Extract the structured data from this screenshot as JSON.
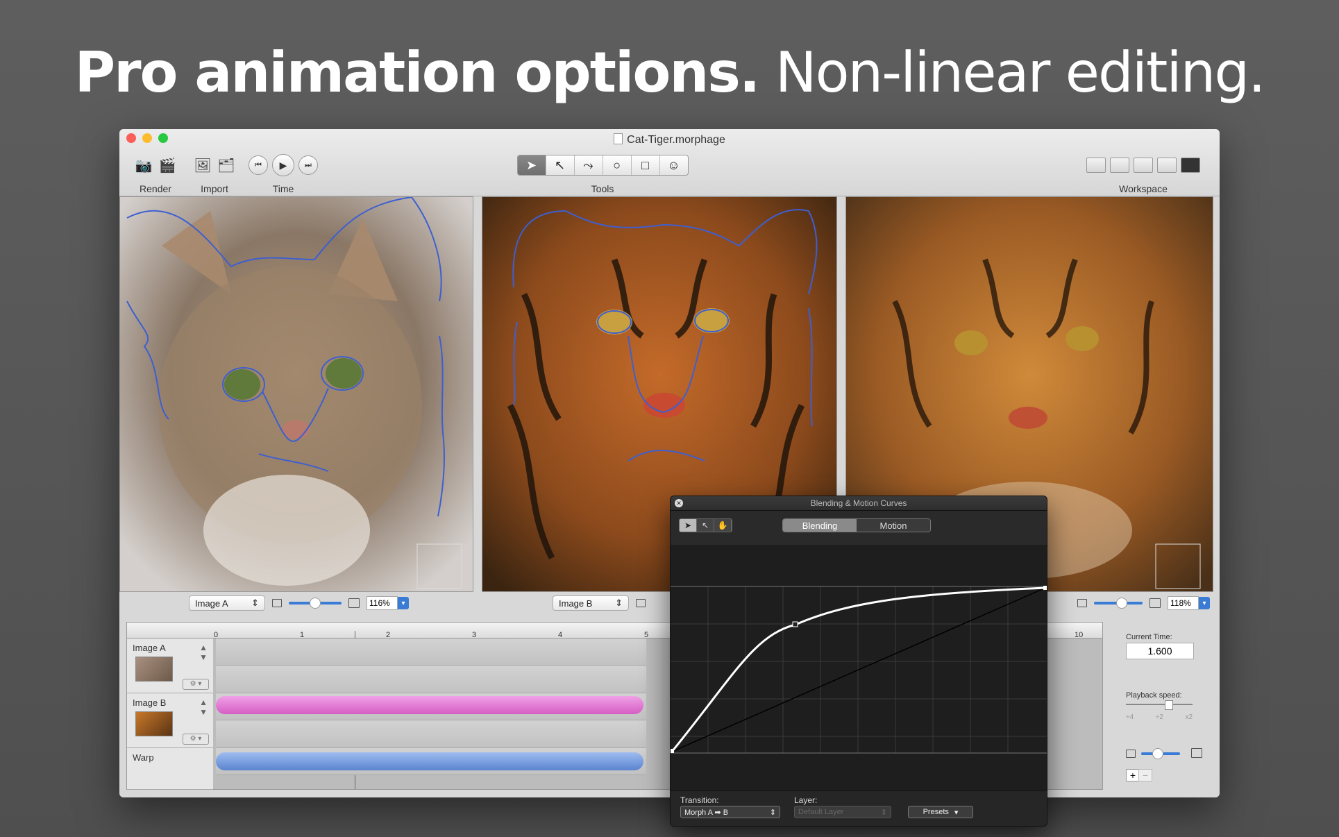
{
  "headline": {
    "bold": "Pro animation options.",
    "light": " Non-linear editing."
  },
  "window": {
    "title": "Cat-Tiger.morphage"
  },
  "toolbar": {
    "render_label": "Render",
    "import_label": "Import",
    "time_label": "Time",
    "tools_label": "Tools",
    "workspace_label": "Workspace"
  },
  "panels": {
    "a": {
      "popup": "Image A",
      "zoom": "116%"
    },
    "b": {
      "popup": "Image B"
    },
    "out": {
      "zoom": "118%"
    }
  },
  "timeline": {
    "ticks": [
      "0",
      "1",
      "2",
      "3",
      "4",
      "5",
      "10"
    ],
    "tracks": [
      {
        "name": "Image A",
        "bar_color": "",
        "thumb": "cat"
      },
      {
        "name": "Image B",
        "bar_color": "#e87ad8",
        "thumb": "tiger"
      },
      {
        "name": "Warp",
        "bar_color": "#6f9be0"
      }
    ],
    "current_time_label": "Current Time:",
    "current_time": "1.600",
    "playback_label": "Playback speed:",
    "speed_ticks": [
      "÷4",
      "÷2",
      "x2"
    ]
  },
  "curves": {
    "title": "Blending & Motion Curves",
    "tabs": [
      "Blending",
      "Motion"
    ],
    "active_tab": "Blending",
    "transition_label": "Transition:",
    "transition_value": "Morph A ➡ B",
    "layer_label": "Layer:",
    "layer_value": "Default Layer",
    "presets_label": "Presets"
  },
  "colors": {
    "accent": "#3a7bd5",
    "pink_bar": "#e87ad8",
    "blue_bar": "#6f9be0"
  }
}
